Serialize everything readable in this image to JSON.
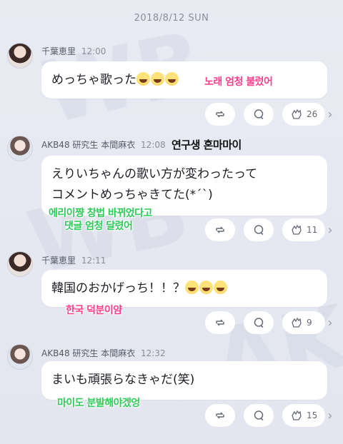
{
  "date_header": "2018/8/12 SUN",
  "posts": [
    {
      "name": "千葉恵里",
      "time": "12:00",
      "text_lines": [
        "めっちゃ歌った"
      ],
      "emoji_count": 3,
      "translations": [
        "노래 엄청 불렀어"
      ],
      "clap_count": "26"
    },
    {
      "name": "AKB48 研究生 本間麻衣",
      "time": "12:08",
      "name_note": "연구생 혼마마이",
      "text_lines": [
        "えりいちゃんの歌い方が変わったって",
        "コメントめっちゃきてた(*´`)"
      ],
      "translations": [
        "에리이쨩 창법 바뀌었다고",
        "댓글 엄청 달렸어"
      ],
      "clap_count": "11"
    },
    {
      "name": "千葉恵里",
      "time": "12:11",
      "text_lines": [
        "韓国のおかげっち！！？"
      ],
      "emoji_count": 3,
      "translations": [
        "한국 덕분이얌"
      ],
      "clap_count": "9"
    },
    {
      "name": "AKB48 研究生 本間麻衣",
      "time": "12:32",
      "text_lines": [
        "まいも頑張らなきゃだ(笑)"
      ],
      "translations": [
        "마이도 분발해야겠엉"
      ],
      "clap_count": "15"
    }
  ],
  "icons": {
    "repost": "repost-icon",
    "comment": "comment-icon",
    "clap": "clap-icon",
    "more": "chevron-right-icon"
  },
  "colors": {
    "background": "#e6e9f1",
    "bubble": "#ffffff",
    "pink_caption": "#ff3d8b",
    "green_caption": "#2ecb5a"
  }
}
